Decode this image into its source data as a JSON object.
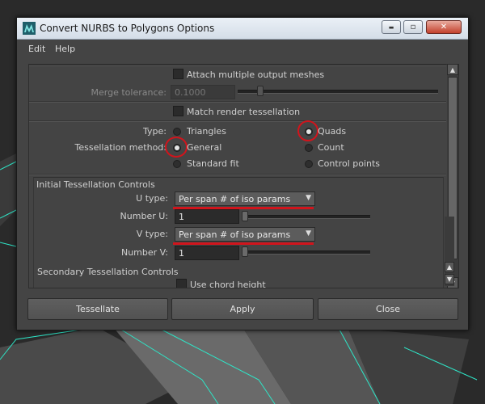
{
  "window": {
    "title": "Convert NURBS to Polygons Options",
    "controls": {
      "minimize": "▬",
      "maximize": "▫",
      "close": "✕"
    }
  },
  "menu": {
    "items": [
      "Edit",
      "Help"
    ]
  },
  "options": {
    "attach_multiple": {
      "label": "Attach multiple output meshes",
      "checked": false
    },
    "merge_tolerance": {
      "label": "Merge tolerance:",
      "value": "0.1000",
      "enabled": false
    },
    "match_render": {
      "label": "Match render tessellation",
      "checked": false
    },
    "type": {
      "label": "Type:",
      "options": [
        "Triangles",
        "Quads"
      ],
      "selected": "Quads"
    },
    "tessellation_method": {
      "label": "Tessellation method:",
      "options": [
        "General",
        "Count",
        "Standard fit",
        "Control points"
      ],
      "selected": "General"
    }
  },
  "initial_controls": {
    "title": "Initial Tessellation Controls",
    "u_type": {
      "label": "U type:",
      "value": "Per span # of iso params"
    },
    "number_u": {
      "label": "Number U:",
      "value": "1"
    },
    "v_type": {
      "label": "V type:",
      "value": "Per span # of iso params"
    },
    "number_v": {
      "label": "Number V:",
      "value": "1"
    }
  },
  "secondary_controls": {
    "title": "Secondary Tessellation Controls",
    "use_chord_height": {
      "label": "Use chord height",
      "checked": false
    }
  },
  "buttons": {
    "tessellate": "Tessellate",
    "apply": "Apply",
    "close": "Close"
  },
  "annotation_color": "#d1141c"
}
